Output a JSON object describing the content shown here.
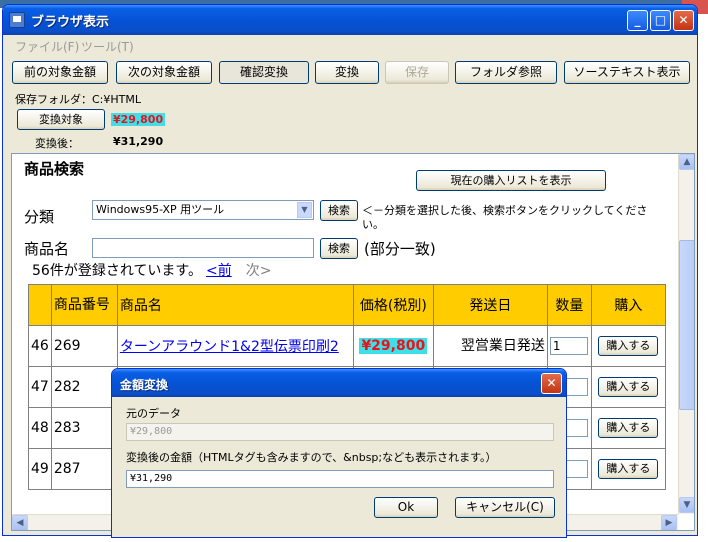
{
  "window": {
    "title": "ブラウザ表示",
    "controls": {
      "minimize": "_",
      "maximize": "□",
      "close": "✕"
    }
  },
  "menu": [
    "ファイル(F)",
    "ツール(T)"
  ],
  "toolbar": {
    "buttons": [
      "前の対象金額",
      "次の対象金額",
      "確認変換",
      "変換",
      "保存",
      "フォルダ参照",
      "ソーステキスト表示"
    ]
  },
  "info": {
    "save_folder": "保存フォルダ：C:¥HTML",
    "target_button": "変換対象",
    "target_amount": "¥29,800",
    "after_label": "変換後：",
    "after_amount": "¥31,290"
  },
  "page": {
    "heading": "商品検索",
    "show_list_button": "現在の購入リストを表示",
    "category_label": "分類",
    "category_value": "Windows95-XP 用ツール",
    "search_button": "検索",
    "hint": "＜－分類を選択した後、検索ボタンをクリックしてください。",
    "name_label": "商品名",
    "name_value": "",
    "search_button2": "検索",
    "partial_match": "(部分一致)",
    "registered": "56件が登録されています。",
    "prev": "<前",
    "next": "次>"
  },
  "table": {
    "headers": [
      "",
      "商品番号",
      "商品名",
      "価格(税別)",
      "発送日",
      "数量",
      "購入"
    ],
    "rows": [
      {
        "idx": "46",
        "code": "269",
        "name": "ターンアラウンド1&2型伝票印刷2",
        "price": "¥29,800",
        "ship": "翌営業日発送",
        "qty": "1",
        "buy": "購入する"
      },
      {
        "idx": "47",
        "code": "282",
        "name": "",
        "price": "",
        "ship": "",
        "qty": "",
        "buy": "購入する"
      },
      {
        "idx": "48",
        "code": "283",
        "name": "",
        "price": "",
        "ship": "",
        "qty": "",
        "buy": "購入する"
      },
      {
        "idx": "49",
        "code": "287",
        "name": "",
        "price": "",
        "ship": "",
        "qty": "",
        "buy": "購入する"
      }
    ]
  },
  "dialog": {
    "title": "金額変換",
    "orig_label": "元のデータ",
    "orig_value": "¥29,800",
    "conv_label": "変換後の金額（HTMLタグも含みますので、&nbsp;なども表示されます。）",
    "conv_value": "¥31,290",
    "ok": "Ok",
    "cancel": "キャンセル(C)",
    "close": "✕"
  },
  "colors": {
    "title_blue": "#0553d6",
    "header_yellow": "#ffcc00",
    "highlight_cyan": "#3de0e8",
    "price_red": "#e8141c",
    "link_blue": "#0000ee"
  }
}
